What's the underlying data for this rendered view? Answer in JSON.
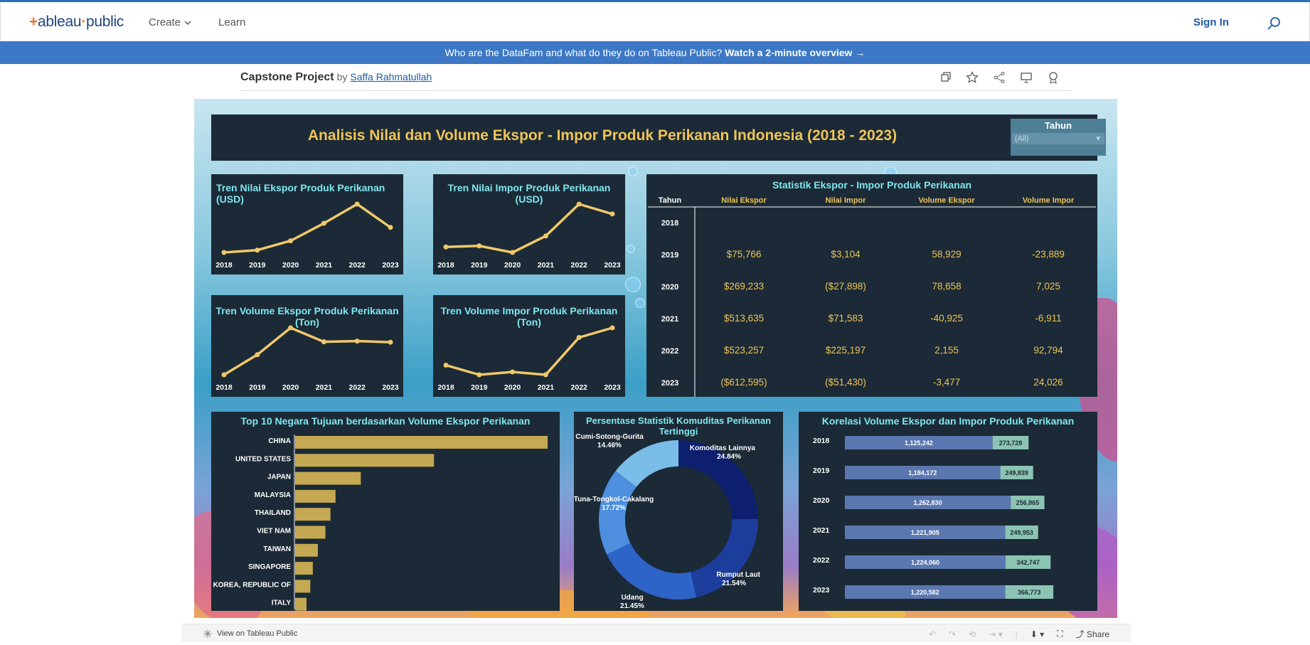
{
  "header": {
    "logo_text": "+ableau+public",
    "nav": [
      "Create",
      "Learn"
    ],
    "sign_in": "Sign In"
  },
  "banner": {
    "text": "Who are the DataFam and what do they do on Tableau Public?",
    "link": "Watch a 2-minute overview →"
  },
  "viz": {
    "title": "Capstone Project",
    "by": "by",
    "author": "Saffa Rahmatullah"
  },
  "dashboard": {
    "title": "Analisis Nilai dan Volume Ekspor - Impor Produk Perikanan Indonesia (2018 - 2023)",
    "filter_label": "Tahun",
    "filter_value": "(All)",
    "colors": {
      "panel": "#1b2a36",
      "line": "#f0c86a",
      "title_text": "#7fe6ee",
      "accent_gold": "#f0c456",
      "bar_gold": "#c4a852",
      "bar_blue": "#5b77b0",
      "bar_green": "#8cc4b3"
    }
  },
  "chart_data": [
    {
      "type": "line",
      "title": "Tren Nilai Ekspor Produk Perikanan (USD)",
      "categories": [
        "2018",
        "2019",
        "2020",
        "2021",
        "2022",
        "2023"
      ],
      "values": [
        0.12,
        0.16,
        0.32,
        0.62,
        0.95,
        0.55
      ]
    },
    {
      "type": "line",
      "title": "Tren Nilai Impor Produk Perikanan (USD)",
      "categories": [
        "2018",
        "2019",
        "2020",
        "2021",
        "2022",
        "2023"
      ],
      "values": [
        0.22,
        0.24,
        0.12,
        0.42,
        1.0,
        0.82
      ]
    },
    {
      "type": "line",
      "title": "Tren Volume Ekspor Produk Perikanan (Ton)",
      "categories": [
        "2018",
        "2019",
        "2020",
        "2021",
        "2022",
        "2023"
      ],
      "values": [
        1125242,
        1184172,
        1262830,
        1221905,
        1224060,
        1220582
      ]
    },
    {
      "type": "line",
      "title": "Tren Volume Impor Produk Perikanan (Ton)",
      "categories": [
        "2018",
        "2019",
        "2020",
        "2021",
        "2022",
        "2023"
      ],
      "values": [
        273728,
        249839,
        256865,
        249953,
        342747,
        366773
      ]
    },
    {
      "type": "table",
      "title": "Statistik Ekspor - Impor Produk Perikanan",
      "columns": [
        "Tahun",
        "Nilai Ekspor",
        "Nilai Impor",
        "Volume Ekspor",
        "Volume Impor"
      ],
      "rows": [
        [
          "2018",
          "",
          "",
          "",
          ""
        ],
        [
          "2019",
          "$75,766",
          "$3,104",
          "58,929",
          "-23,889"
        ],
        [
          "2020",
          "$269,233",
          "($27,898)",
          "78,658",
          "7,025"
        ],
        [
          "2021",
          "$513,635",
          "$71,583",
          "-40,925",
          "-6,911"
        ],
        [
          "2022",
          "$523,257",
          "$225,197",
          "2,155",
          "92,794"
        ],
        [
          "2023",
          "($612,595)",
          "($51,430)",
          "-3,477",
          "24,026"
        ]
      ]
    },
    {
      "type": "bar",
      "title": "Top 10 Negara Tujuan berdasarkan Volume Ekspor Perikanan",
      "categories": [
        "CHINA",
        "UNITED STATES",
        "JAPAN",
        "MALAYSIA",
        "THAILAND",
        "VIET NAM",
        "TAIWAN",
        "SINGAPORE",
        "KOREA, REPUBLIC OF",
        "ITALY"
      ],
      "values": [
        100,
        55,
        26,
        16,
        14,
        12,
        9,
        7,
        6,
        4.5
      ]
    },
    {
      "type": "pie",
      "title": "Persentase Statistik Komuditas Perikanan Tertinggi",
      "categories": [
        "Komoditas Lainnya",
        "Rumput Laut",
        "Udang",
        "Tuna-Tongkol-Cakalang",
        "Cumi-Sotong-Gurita"
      ],
      "values": [
        24.84,
        21.54,
        21.45,
        17.72,
        14.46
      ],
      "labels": [
        "24.84%",
        "21.54%",
        "21.45%",
        "17.72%",
        "14.46%"
      ],
      "colors": [
        "#0d1f6e",
        "#1c3d9c",
        "#2e63c8",
        "#4d8fde",
        "#79bde8"
      ]
    },
    {
      "type": "bar",
      "title": "Korelasi Volume Ekspor dan Impor Produk Perikanan",
      "categories": [
        "2018",
        "2019",
        "2020",
        "2021",
        "2022",
        "2023"
      ],
      "series": [
        {
          "name": "Volume Ekspor",
          "values": [
            1125242,
            1184172,
            1262830,
            1221905,
            1224060,
            1220582
          ],
          "labels": [
            "1,125,242",
            "1,184,172",
            "1,262,830",
            "1,221,905",
            "1,224,060",
            "1,220,582"
          ]
        },
        {
          "name": "Volume Impor",
          "values": [
            273728,
            249839,
            256865,
            249953,
            342747,
            366773
          ],
          "labels": [
            "273,728",
            "249,839",
            "256,865",
            "249,953",
            "342,747",
            "366,773"
          ]
        }
      ]
    }
  ],
  "footer": {
    "view_on": "View on Tableau Public",
    "share": "Share"
  }
}
